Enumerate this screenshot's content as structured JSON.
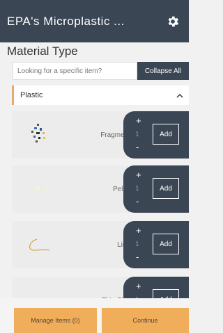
{
  "header": {
    "title": "EPA's Microplastic ...",
    "settings_icon": "gear-icon"
  },
  "material": {
    "title": "Material Type",
    "search_placeholder": "Looking for a specific item?",
    "collapse_label": "Collapse All"
  },
  "category": {
    "label": "Plastic",
    "chevron_icon": "chevron-up-icon",
    "accent_color": "#e9a96a"
  },
  "items": [
    {
      "name": "Fragment",
      "qty": "1",
      "add_label": "Add",
      "plus": "+",
      "minus": "-"
    },
    {
      "name": "Pellet",
      "qty": "1",
      "add_label": "Add",
      "plus": "+",
      "minus": "-"
    },
    {
      "name": "Line",
      "qty": "1",
      "add_label": "Add",
      "plus": "+",
      "minus": "-"
    },
    {
      "name": "Thin Film",
      "qty": "1",
      "add_label": "Add",
      "plus": "+",
      "minus": "-"
    }
  ],
  "footer": {
    "manage_label": "Manage Items (0)",
    "continue_label": "Continue"
  },
  "colors": {
    "header_bg": "#3b4654",
    "accent": "#f0ad5a"
  }
}
